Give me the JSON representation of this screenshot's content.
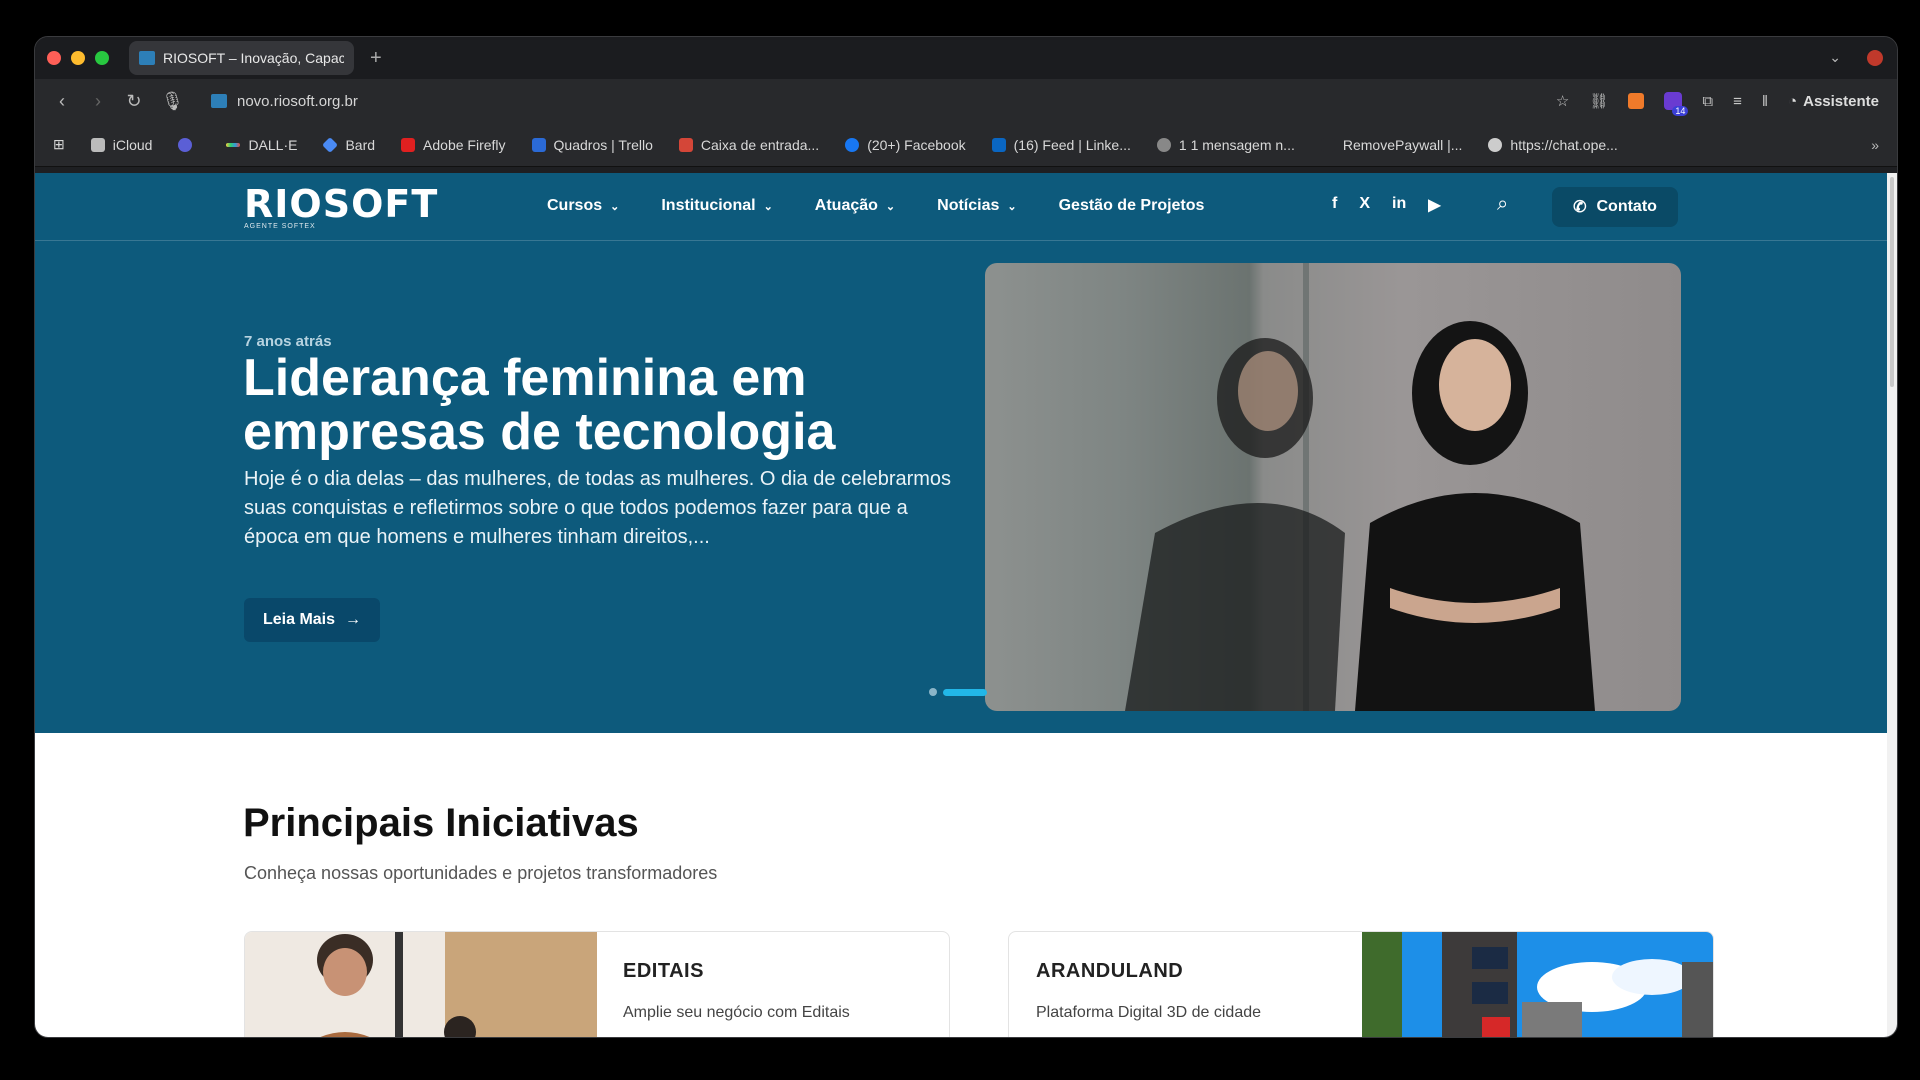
{
  "browser": {
    "tab_title": "RIOSOFT – Inovação, Capac",
    "url": "novo.riosoft.org.br",
    "assistant_label": "Assistente",
    "ext_badge": "14",
    "bookmarks": [
      {
        "label": "iCloud",
        "color": "#bbbbbb"
      },
      {
        "label": "",
        "color": "#5b5fd6"
      },
      {
        "label": "DALL·E",
        "color": "#ffffff"
      },
      {
        "label": "Bard",
        "color": "#4a8af4"
      },
      {
        "label": "Adobe Firefly",
        "color": "#e02020"
      },
      {
        "label": "Quadros | Trello",
        "color": "#2b6ad6"
      },
      {
        "label": "Caixa de entrada...",
        "color": "#d44638"
      },
      {
        "label": "(20+) Facebook",
        "color": "#1877f2"
      },
      {
        "label": "(16) Feed | Linke...",
        "color": "#0a66c2"
      },
      {
        "label": "1 1 mensagem n...",
        "color": "#888888"
      },
      {
        "label": "RemovePaywall |...",
        "color": "#28292c"
      },
      {
        "label": "https://chat.ope...",
        "color": "#cccccc"
      }
    ]
  },
  "site": {
    "logo": "RIOSOFT",
    "logo_sub": "AGENTE SOFTEX",
    "nav": [
      {
        "label": "Cursos",
        "dropdown": true
      },
      {
        "label": "Institucional",
        "dropdown": true
      },
      {
        "label": "Atuação",
        "dropdown": true
      },
      {
        "label": "Notícias",
        "dropdown": true
      },
      {
        "label": "Gestão de Projetos",
        "dropdown": false
      }
    ],
    "social": [
      "f",
      "X",
      "in",
      "▶"
    ],
    "contact_label": "Contato"
  },
  "hero": {
    "date": "7 anos atrás",
    "title": "Liderança feminina em empresas de tecnologia",
    "text": "Hoje é o dia delas – das mulheres, de todas as mulheres. O dia de celebrarmos suas conquistas e refletirmos sobre o que todos podemos fazer para que a época em que homens e mulheres tinham direitos,...",
    "button_label": "Leia Mais",
    "slide_count": 2,
    "active_slide": 2
  },
  "initiatives": {
    "title": "Principais Iniciativas",
    "subtitle": "Conheça nossas oportunidades e projetos transformadores",
    "cards": [
      {
        "title": "EDITAIS",
        "desc": "Amplie seu negócio com Editais"
      },
      {
        "title": "ARANDULAND",
        "desc": "Plataforma Digital 3D de cidade"
      }
    ]
  },
  "colors": {
    "hero_bg": "#0d5a7c",
    "accent": "#22b7e8"
  }
}
